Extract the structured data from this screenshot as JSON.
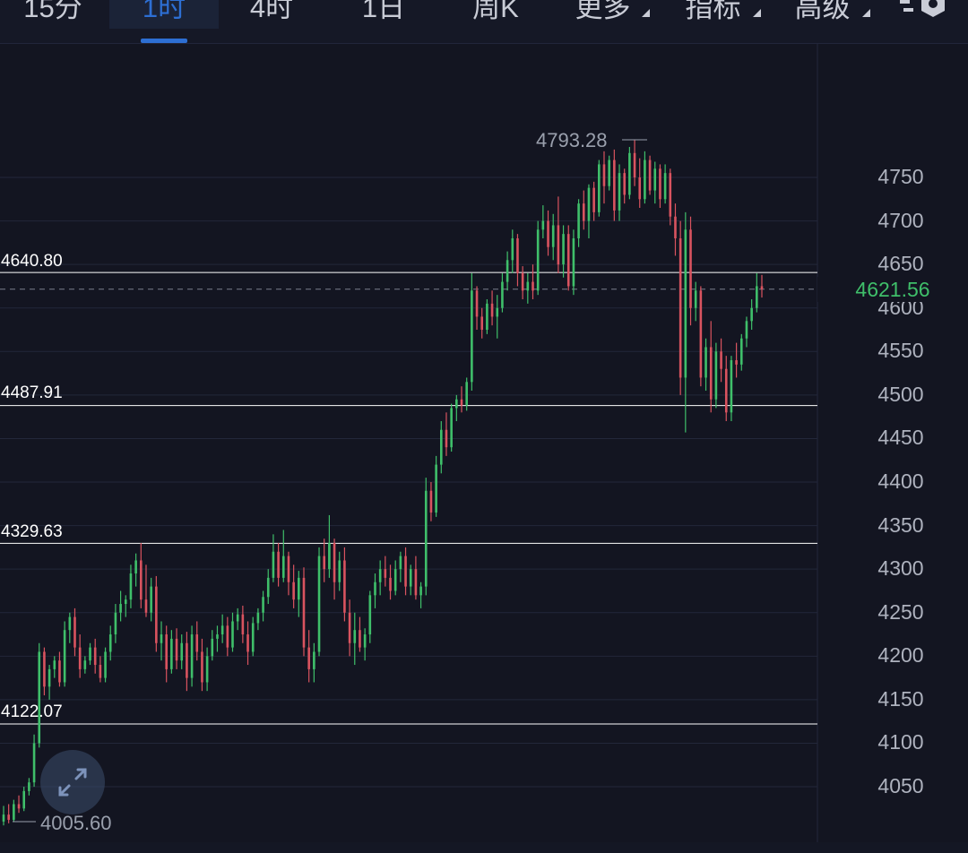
{
  "toolbar": {
    "tabs": [
      {
        "label": "15分",
        "active": false
      },
      {
        "label": "1时",
        "active": true
      },
      {
        "label": "4时",
        "active": false
      },
      {
        "label": "1日",
        "active": false
      },
      {
        "label": "周K",
        "active": false
      },
      {
        "label": "更多",
        "active": false,
        "dropdown": true
      },
      {
        "label": "指标",
        "active": false,
        "dropdown": true
      },
      {
        "label": "高级",
        "active": false,
        "dropdown": true
      }
    ],
    "settings_icon": "hexagon-settings-icon"
  },
  "colors": {
    "background": "#131521",
    "up": "#3fbf6a",
    "down": "#d9535f",
    "accent": "#2d6fd3",
    "level_line": "#ffffff",
    "grid": "#23273a"
  },
  "chart": {
    "price_axis": [
      "4750",
      "4700",
      "4650",
      "4600",
      "4550",
      "4500",
      "4450",
      "4400",
      "4350",
      "4300",
      "4250",
      "4200",
      "4150",
      "4100",
      "4050"
    ],
    "current_price": "4621.56",
    "high_label": "4793.28",
    "low_label": "4005.60",
    "levels": [
      "4640.80",
      "4487.91",
      "4329.63",
      "4122.07"
    ]
  },
  "chart_data": {
    "type": "candlestick",
    "timeframe": "1时",
    "ylim": [
      4000,
      4800
    ],
    "candles": [
      {
        "o": 4010,
        "h": 4028,
        "l": 4005.6,
        "c": 4018
      },
      {
        "o": 4018,
        "h": 4030,
        "l": 4008,
        "c": 4012
      },
      {
        "o": 4012,
        "h": 4035,
        "l": 4010,
        "c": 4030
      },
      {
        "o": 4030,
        "h": 4040,
        "l": 4020,
        "c": 4025
      },
      {
        "o": 4025,
        "h": 4050,
        "l": 4022,
        "c": 4045
      },
      {
        "o": 4045,
        "h": 4060,
        "l": 4040,
        "c": 4055
      },
      {
        "o": 4055,
        "h": 4110,
        "l": 4050,
        "c": 4100
      },
      {
        "o": 4100,
        "h": 4215,
        "l": 4095,
        "c": 4205
      },
      {
        "o": 4205,
        "h": 4210,
        "l": 4155,
        "c": 4165
      },
      {
        "o": 4165,
        "h": 4190,
        "l": 4150,
        "c": 4185
      },
      {
        "o": 4185,
        "h": 4200,
        "l": 4175,
        "c": 4195
      },
      {
        "o": 4195,
        "h": 4205,
        "l": 4165,
        "c": 4170
      },
      {
        "o": 4170,
        "h": 4240,
        "l": 4165,
        "c": 4230
      },
      {
        "o": 4230,
        "h": 4250,
        "l": 4215,
        "c": 4245
      },
      {
        "o": 4245,
        "h": 4255,
        "l": 4200,
        "c": 4210
      },
      {
        "o": 4210,
        "h": 4225,
        "l": 4175,
        "c": 4185
      },
      {
        "o": 4185,
        "h": 4200,
        "l": 4180,
        "c": 4195
      },
      {
        "o": 4195,
        "h": 4215,
        "l": 4190,
        "c": 4210
      },
      {
        "o": 4210,
        "h": 4220,
        "l": 4180,
        "c": 4190
      },
      {
        "o": 4190,
        "h": 4200,
        "l": 4170,
        "c": 4175
      },
      {
        "o": 4175,
        "h": 4210,
        "l": 4170,
        "c": 4205
      },
      {
        "o": 4205,
        "h": 4235,
        "l": 4195,
        "c": 4225
      },
      {
        "o": 4225,
        "h": 4260,
        "l": 4215,
        "c": 4250
      },
      {
        "o": 4250,
        "h": 4275,
        "l": 4240,
        "c": 4260
      },
      {
        "o": 4260,
        "h": 4270,
        "l": 4245,
        "c": 4265
      },
      {
        "o": 4265,
        "h": 4305,
        "l": 4255,
        "c": 4295
      },
      {
        "o": 4295,
        "h": 4318,
        "l": 4280,
        "c": 4310
      },
      {
        "o": 4310,
        "h": 4330,
        "l": 4255,
        "c": 4265
      },
      {
        "o": 4265,
        "h": 4305,
        "l": 4245,
        "c": 4250
      },
      {
        "o": 4250,
        "h": 4290,
        "l": 4240,
        "c": 4280
      },
      {
        "o": 4280,
        "h": 4292,
        "l": 4205,
        "c": 4215
      },
      {
        "o": 4215,
        "h": 4240,
        "l": 4195,
        "c": 4225
      },
      {
        "o": 4225,
        "h": 4235,
        "l": 4170,
        "c": 4185
      },
      {
        "o": 4185,
        "h": 4230,
        "l": 4180,
        "c": 4220
      },
      {
        "o": 4220,
        "h": 4232,
        "l": 4185,
        "c": 4195
      },
      {
        "o": 4195,
        "h": 4225,
        "l": 4185,
        "c": 4215
      },
      {
        "o": 4215,
        "h": 4228,
        "l": 4160,
        "c": 4175
      },
      {
        "o": 4175,
        "h": 4235,
        "l": 4165,
        "c": 4225
      },
      {
        "o": 4225,
        "h": 4240,
        "l": 4195,
        "c": 4205
      },
      {
        "o": 4205,
        "h": 4220,
        "l": 4160,
        "c": 4170
      },
      {
        "o": 4170,
        "h": 4210,
        "l": 4160,
        "c": 4200
      },
      {
        "o": 4200,
        "h": 4230,
        "l": 4195,
        "c": 4220
      },
      {
        "o": 4220,
        "h": 4235,
        "l": 4205,
        "c": 4225
      },
      {
        "o": 4225,
        "h": 4248,
        "l": 4215,
        "c": 4235
      },
      {
        "o": 4235,
        "h": 4245,
        "l": 4200,
        "c": 4210
      },
      {
        "o": 4210,
        "h": 4250,
        "l": 4205,
        "c": 4240
      },
      {
        "o": 4240,
        "h": 4255,
        "l": 4230,
        "c": 4248
      },
      {
        "o": 4248,
        "h": 4258,
        "l": 4215,
        "c": 4225
      },
      {
        "o": 4225,
        "h": 4240,
        "l": 4190,
        "c": 4205
      },
      {
        "o": 4205,
        "h": 4245,
        "l": 4200,
        "c": 4238
      },
      {
        "o": 4238,
        "h": 4255,
        "l": 4230,
        "c": 4250
      },
      {
        "o": 4250,
        "h": 4275,
        "l": 4240,
        "c": 4268
      },
      {
        "o": 4268,
        "h": 4300,
        "l": 4260,
        "c": 4290
      },
      {
        "o": 4290,
        "h": 4340,
        "l": 4285,
        "c": 4320
      },
      {
        "o": 4320,
        "h": 4330,
        "l": 4280,
        "c": 4290
      },
      {
        "o": 4290,
        "h": 4345,
        "l": 4285,
        "c": 4315
      },
      {
        "o": 4315,
        "h": 4320,
        "l": 4270,
        "c": 4285
      },
      {
        "o": 4285,
        "h": 4305,
        "l": 4255,
        "c": 4265
      },
      {
        "o": 4265,
        "h": 4298,
        "l": 4245,
        "c": 4290
      },
      {
        "o": 4290,
        "h": 4302,
        "l": 4200,
        "c": 4210
      },
      {
        "o": 4210,
        "h": 4230,
        "l": 4170,
        "c": 4185
      },
      {
        "o": 4185,
        "h": 4215,
        "l": 4170,
        "c": 4205
      },
      {
        "o": 4205,
        "h": 4325,
        "l": 4200,
        "c": 4315
      },
      {
        "o": 4315,
        "h": 4335,
        "l": 4285,
        "c": 4300
      },
      {
        "o": 4300,
        "h": 4362,
        "l": 4290,
        "c": 4330
      },
      {
        "o": 4330,
        "h": 4335,
        "l": 4265,
        "c": 4285
      },
      {
        "o": 4285,
        "h": 4320,
        "l": 4275,
        "c": 4310
      },
      {
        "o": 4310,
        "h": 4325,
        "l": 4240,
        "c": 4250
      },
      {
        "o": 4250,
        "h": 4265,
        "l": 4200,
        "c": 4215
      },
      {
        "o": 4215,
        "h": 4250,
        "l": 4190,
        "c": 4230
      },
      {
        "o": 4230,
        "h": 4245,
        "l": 4205,
        "c": 4210
      },
      {
        "o": 4210,
        "h": 4232,
        "l": 4195,
        "c": 4225
      },
      {
        "o": 4225,
        "h": 4275,
        "l": 4215,
        "c": 4270
      },
      {
        "o": 4270,
        "h": 4295,
        "l": 4255,
        "c": 4285
      },
      {
        "o": 4285,
        "h": 4310,
        "l": 4270,
        "c": 4300
      },
      {
        "o": 4300,
        "h": 4315,
        "l": 4280,
        "c": 4290
      },
      {
        "o": 4290,
        "h": 4305,
        "l": 4265,
        "c": 4275
      },
      {
        "o": 4275,
        "h": 4310,
        "l": 4270,
        "c": 4300
      },
      {
        "o": 4300,
        "h": 4320,
        "l": 4285,
        "c": 4315
      },
      {
        "o": 4315,
        "h": 4325,
        "l": 4270,
        "c": 4280
      },
      {
        "o": 4280,
        "h": 4305,
        "l": 4270,
        "c": 4300
      },
      {
        "o": 4300,
        "h": 4315,
        "l": 4265,
        "c": 4270
      },
      {
        "o": 4270,
        "h": 4285,
        "l": 4255,
        "c": 4280
      },
      {
        "o": 4280,
        "h": 4405,
        "l": 4270,
        "c": 4390
      },
      {
        "o": 4390,
        "h": 4400,
        "l": 4355,
        "c": 4365
      },
      {
        "o": 4365,
        "h": 4430,
        "l": 4360,
        "c": 4420
      },
      {
        "o": 4420,
        "h": 4470,
        "l": 4410,
        "c": 4460
      },
      {
        "o": 4460,
        "h": 4480,
        "l": 4430,
        "c": 4440
      },
      {
        "o": 4440,
        "h": 4490,
        "l": 4435,
        "c": 4485
      },
      {
        "o": 4485,
        "h": 4500,
        "l": 4470,
        "c": 4495
      },
      {
        "o": 4495,
        "h": 4510,
        "l": 4480,
        "c": 4488
      },
      {
        "o": 4488,
        "h": 4520,
        "l": 4482,
        "c": 4515
      },
      {
        "o": 4515,
        "h": 4640,
        "l": 4505,
        "c": 4620
      },
      {
        "o": 4620,
        "h": 4625,
        "l": 4575,
        "c": 4590
      },
      {
        "o": 4590,
        "h": 4600,
        "l": 4565,
        "c": 4575
      },
      {
        "o": 4575,
        "h": 4610,
        "l": 4570,
        "c": 4605
      },
      {
        "o": 4605,
        "h": 4620,
        "l": 4580,
        "c": 4590
      },
      {
        "o": 4590,
        "h": 4615,
        "l": 4565,
        "c": 4600
      },
      {
        "o": 4600,
        "h": 4640,
        "l": 4595,
        "c": 4630
      },
      {
        "o": 4630,
        "h": 4665,
        "l": 4620,
        "c": 4655
      },
      {
        "o": 4655,
        "h": 4690,
        "l": 4640,
        "c": 4680
      },
      {
        "o": 4680,
        "h": 4685,
        "l": 4625,
        "c": 4640
      },
      {
        "o": 4640,
        "h": 4648,
        "l": 4610,
        "c": 4620
      },
      {
        "o": 4620,
        "h": 4640,
        "l": 4605,
        "c": 4630
      },
      {
        "o": 4630,
        "h": 4650,
        "l": 4610,
        "c": 4620
      },
      {
        "o": 4620,
        "h": 4700,
        "l": 4615,
        "c": 4690
      },
      {
        "o": 4690,
        "h": 4718,
        "l": 4680,
        "c": 4700
      },
      {
        "o": 4700,
        "h": 4712,
        "l": 4660,
        "c": 4670
      },
      {
        "o": 4670,
        "h": 4708,
        "l": 4655,
        "c": 4695
      },
      {
        "o": 4695,
        "h": 4728,
        "l": 4640,
        "c": 4650
      },
      {
        "o": 4650,
        "h": 4695,
        "l": 4635,
        "c": 4685
      },
      {
        "o": 4685,
        "h": 4695,
        "l": 4620,
        "c": 4625
      },
      {
        "o": 4625,
        "h": 4690,
        "l": 4615,
        "c": 4680
      },
      {
        "o": 4680,
        "h": 4725,
        "l": 4670,
        "c": 4720
      },
      {
        "o": 4720,
        "h": 4735,
        "l": 4690,
        "c": 4700
      },
      {
        "o": 4700,
        "h": 4742,
        "l": 4680,
        "c": 4738
      },
      {
        "o": 4738,
        "h": 4745,
        "l": 4700,
        "c": 4710
      },
      {
        "o": 4710,
        "h": 4770,
        "l": 4705,
        "c": 4765
      },
      {
        "o": 4765,
        "h": 4780,
        "l": 4720,
        "c": 4740
      },
      {
        "o": 4740,
        "h": 4775,
        "l": 4735,
        "c": 4770
      },
      {
        "o": 4770,
        "h": 4782,
        "l": 4700,
        "c": 4712
      },
      {
        "o": 4712,
        "h": 4765,
        "l": 4700,
        "c": 4755
      },
      {
        "o": 4755,
        "h": 4760,
        "l": 4720,
        "c": 4730
      },
      {
        "o": 4730,
        "h": 4785,
        "l": 4725,
        "c": 4778
      },
      {
        "o": 4778,
        "h": 4793.28,
        "l": 4740,
        "c": 4750
      },
      {
        "o": 4750,
        "h": 4772,
        "l": 4715,
        "c": 4725
      },
      {
        "o": 4725,
        "h": 4780,
        "l": 4720,
        "c": 4770
      },
      {
        "o": 4770,
        "h": 4775,
        "l": 4730,
        "c": 4735
      },
      {
        "o": 4735,
        "h": 4768,
        "l": 4720,
        "c": 4760
      },
      {
        "o": 4760,
        "h": 4765,
        "l": 4715,
        "c": 4725
      },
      {
        "o": 4725,
        "h": 4765,
        "l": 4720,
        "c": 4755
      },
      {
        "o": 4755,
        "h": 4760,
        "l": 4695,
        "c": 4705
      },
      {
        "o": 4705,
        "h": 4720,
        "l": 4660,
        "c": 4680
      },
      {
        "o": 4680,
        "h": 4700,
        "l": 4500,
        "c": 4520
      },
      {
        "o": 4520,
        "h": 4710,
        "l": 4457,
        "c": 4690
      },
      {
        "o": 4690,
        "h": 4705,
        "l": 4580,
        "c": 4600
      },
      {
        "o": 4600,
        "h": 4630,
        "l": 4585,
        "c": 4620
      },
      {
        "o": 4620,
        "h": 4625,
        "l": 4510,
        "c": 4520
      },
      {
        "o": 4520,
        "h": 4565,
        "l": 4505,
        "c": 4555
      },
      {
        "o": 4555,
        "h": 4585,
        "l": 4480,
        "c": 4495
      },
      {
        "o": 4495,
        "h": 4560,
        "l": 4485,
        "c": 4550
      },
      {
        "o": 4550,
        "h": 4565,
        "l": 4515,
        "c": 4530
      },
      {
        "o": 4530,
        "h": 4545,
        "l": 4470,
        "c": 4480
      },
      {
        "o": 4480,
        "h": 4545,
        "l": 4470,
        "c": 4540
      },
      {
        "o": 4540,
        "h": 4560,
        "l": 4520,
        "c": 4535
      },
      {
        "o": 4535,
        "h": 4570,
        "l": 4528,
        "c": 4565
      },
      {
        "o": 4565,
        "h": 4590,
        "l": 4555,
        "c": 4585
      },
      {
        "o": 4585,
        "h": 4610,
        "l": 4575,
        "c": 4600
      },
      {
        "o": 4600,
        "h": 4640,
        "l": 4595,
        "c": 4625
      },
      {
        "o": 4625,
        "h": 4638,
        "l": 4612,
        "c": 4621.56
      }
    ]
  }
}
